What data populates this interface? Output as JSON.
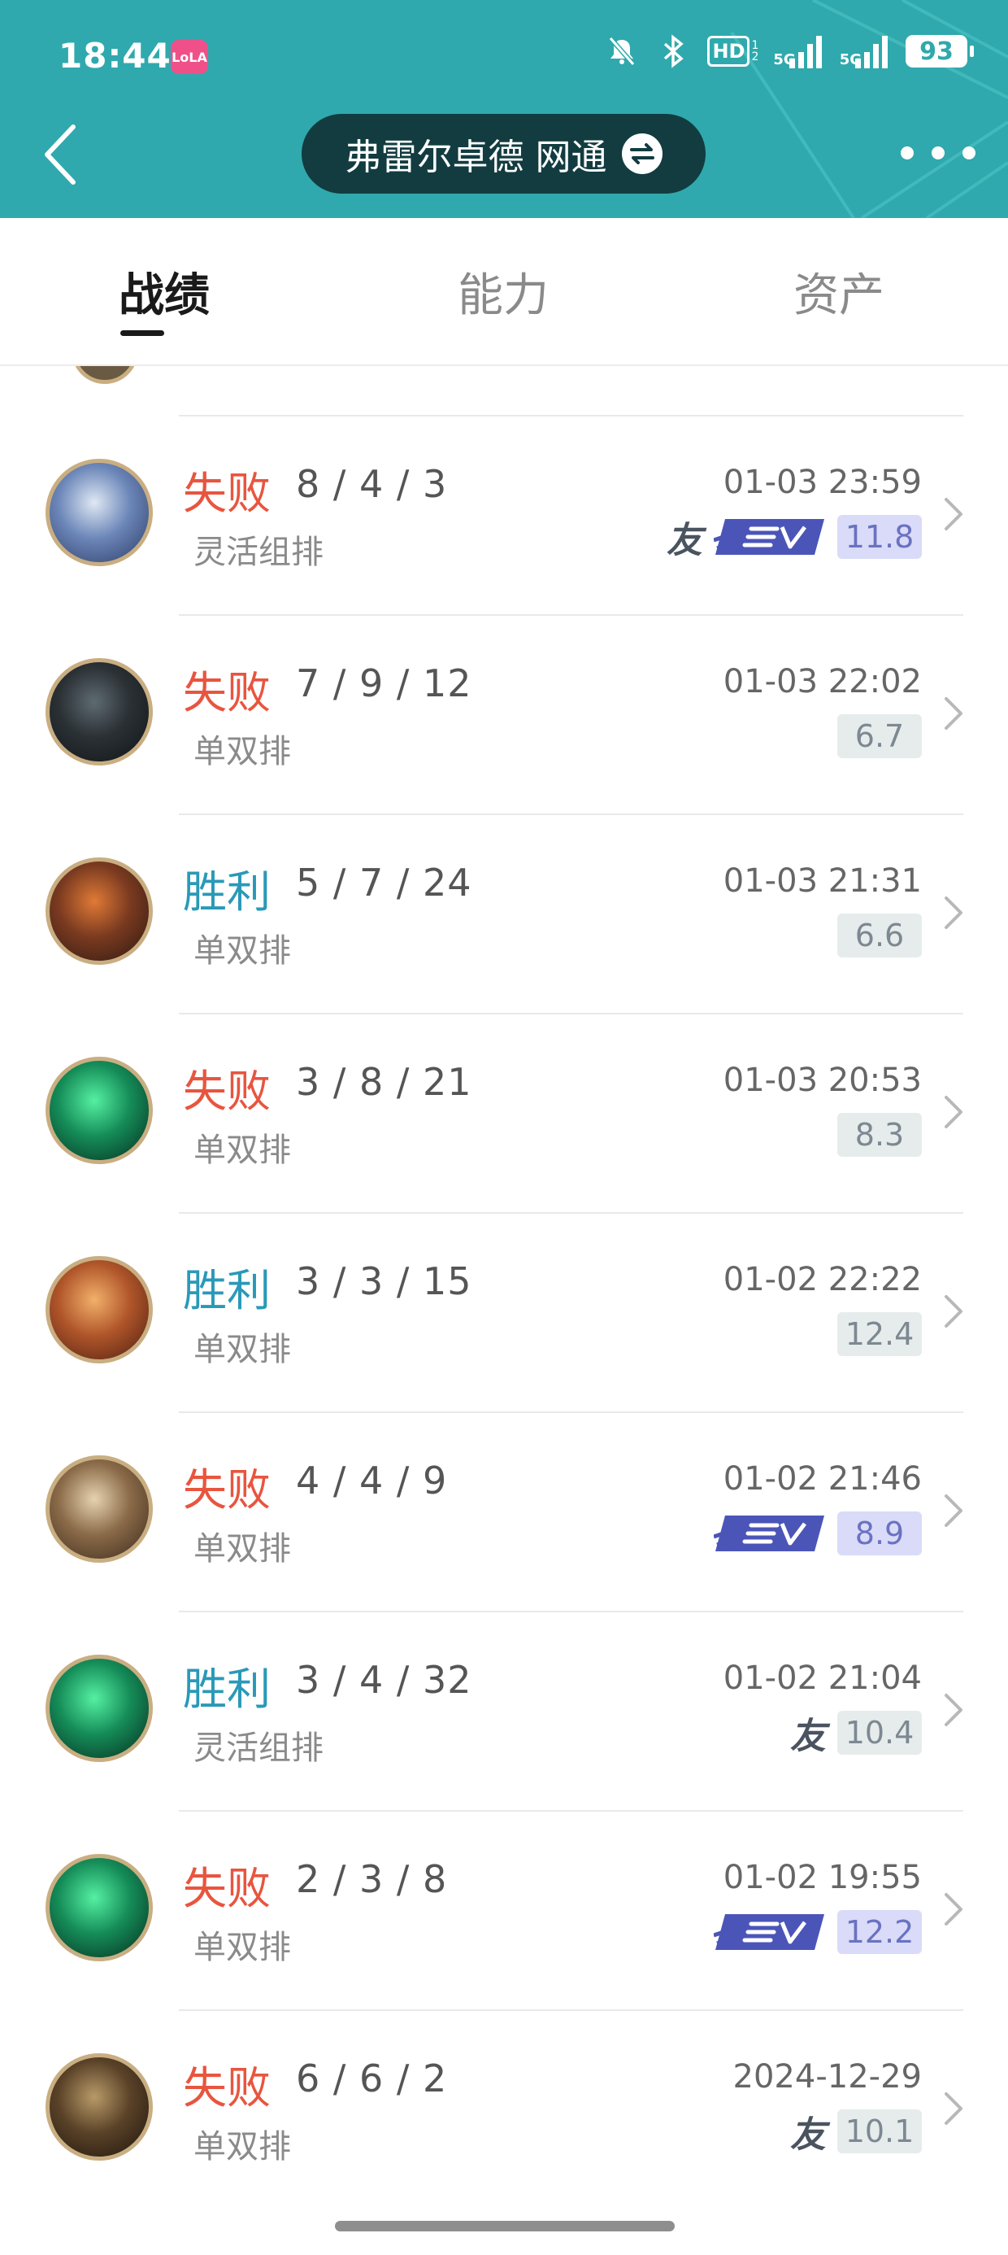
{
  "status_bar": {
    "time": "18:44",
    "app_badge": "LoLA",
    "hd_label": "HD",
    "hd_sub": [
      "1",
      "2"
    ],
    "net1": "5G",
    "net2": "5G",
    "battery": "93",
    "icons": [
      "bell-off-icon",
      "bluetooth-icon",
      "signal-icon",
      "signal-icon"
    ]
  },
  "header": {
    "account_name": "弗雷尔卓德 网通",
    "background_color": "#2fa9ad",
    "pill_color": "#123c40"
  },
  "tabs": [
    {
      "label": "战绩",
      "active": true
    },
    {
      "label": "能力",
      "active": false
    },
    {
      "label": "资产",
      "active": false
    }
  ],
  "matches": [
    {
      "result": "失败",
      "outcome": "lose",
      "kda": "8 / 4 / 3",
      "queue": "灵活组排",
      "time": "01-03 23:59",
      "friend_tag": "友",
      "svp": true,
      "score": "11.8",
      "score_style": "mvp",
      "avatar_colors": [
        "#dfe8f4",
        "#6b86b8",
        "#2c3b66"
      ]
    },
    {
      "result": "失败",
      "outcome": "lose",
      "kda": "7 / 9 / 12",
      "queue": "单双排",
      "time": "01-03 22:02",
      "friend_tag": "",
      "svp": false,
      "score": "6.7",
      "score_style": "normal",
      "avatar_colors": [
        "#5e6a72",
        "#2a3034",
        "#0f1416"
      ]
    },
    {
      "result": "胜利",
      "outcome": "win",
      "kda": "5 / 7 / 24",
      "queue": "单双排",
      "time": "01-03 21:31",
      "friend_tag": "",
      "svp": false,
      "score": "6.6",
      "score_style": "normal",
      "avatar_colors": [
        "#e07a36",
        "#7a3a20",
        "#2b1810"
      ]
    },
    {
      "result": "失败",
      "outcome": "lose",
      "kda": "3 / 8 / 21",
      "queue": "单双排",
      "time": "01-03 20:53",
      "friend_tag": "",
      "svp": false,
      "score": "8.3",
      "score_style": "normal",
      "avatar_colors": [
        "#55f0a2",
        "#158c58",
        "#062a1e"
      ]
    },
    {
      "result": "胜利",
      "outcome": "win",
      "kda": "3 / 3 / 15",
      "queue": "单双排",
      "time": "01-02 22:22",
      "friend_tag": "",
      "svp": false,
      "score": "12.4",
      "score_style": "normal",
      "avatar_colors": [
        "#f2b06a",
        "#b0552a",
        "#4a1e10"
      ]
    },
    {
      "result": "失败",
      "outcome": "lose",
      "kda": "4 / 4 / 9",
      "queue": "单双排",
      "time": "01-02 21:46",
      "friend_tag": "",
      "svp": true,
      "score": "8.9",
      "score_style": "mvp",
      "avatar_colors": [
        "#e6d2b0",
        "#8a6a48",
        "#3a2a1c"
      ]
    },
    {
      "result": "胜利",
      "outcome": "win",
      "kda": "3 / 4 / 32",
      "queue": "灵活组排",
      "time": "01-02 21:04",
      "friend_tag": "友",
      "svp": false,
      "score": "10.4",
      "score_style": "normal",
      "avatar_colors": [
        "#55f0a2",
        "#158c58",
        "#062a1e"
      ]
    },
    {
      "result": "失败",
      "outcome": "lose",
      "kda": "2 / 3 / 8",
      "queue": "单双排",
      "time": "01-02 19:55",
      "friend_tag": "",
      "svp": true,
      "score": "12.2",
      "score_style": "mvp",
      "avatar_colors": [
        "#55f0a2",
        "#158c58",
        "#062a1e"
      ]
    },
    {
      "result": "失败",
      "outcome": "lose",
      "kda": "6 / 6 / 2",
      "queue": "单双排",
      "time": "2024-12-29",
      "friend_tag": "友",
      "svp": false,
      "score": "10.1",
      "score_style": "normal",
      "avatar_colors": [
        "#b89a68",
        "#5a4228",
        "#1c140c"
      ]
    }
  ],
  "colors": {
    "lose": "#e8553f",
    "win": "#2a99b8",
    "mvp_bg": "#d9dbf8",
    "score_bg": "#e6ecec"
  }
}
